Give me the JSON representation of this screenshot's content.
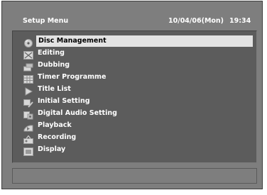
{
  "header": {
    "title": "Setup Menu",
    "date": "10/04/06(Mon)",
    "time": "19:34"
  },
  "menu": {
    "items": [
      {
        "label": "Disc Management",
        "icon": "disc-icon",
        "selected": true
      },
      {
        "label": "Editing",
        "icon": "scissors-icon",
        "selected": false
      },
      {
        "label": "Dubbing",
        "icon": "dubbing-icon",
        "selected": false
      },
      {
        "label": "Timer Programme",
        "icon": "timer-grid-icon",
        "selected": false
      },
      {
        "label": "Title List",
        "icon": "play-icon",
        "selected": false
      },
      {
        "label": "Initial Setting",
        "icon": "wrench-icon",
        "selected": false
      },
      {
        "label": "Digital Audio Setting",
        "icon": "speaker-icon",
        "selected": false
      },
      {
        "label": "Playback",
        "icon": "playback-icon",
        "selected": false
      },
      {
        "label": "Recording",
        "icon": "recording-icon",
        "selected": false
      },
      {
        "label": "Display",
        "icon": "display-icon",
        "selected": false
      }
    ]
  },
  "colors": {
    "background": "#7e7e7e",
    "panel": "#5c5c5c",
    "highlight": "#e3e3e3",
    "text": "#ffffff"
  }
}
